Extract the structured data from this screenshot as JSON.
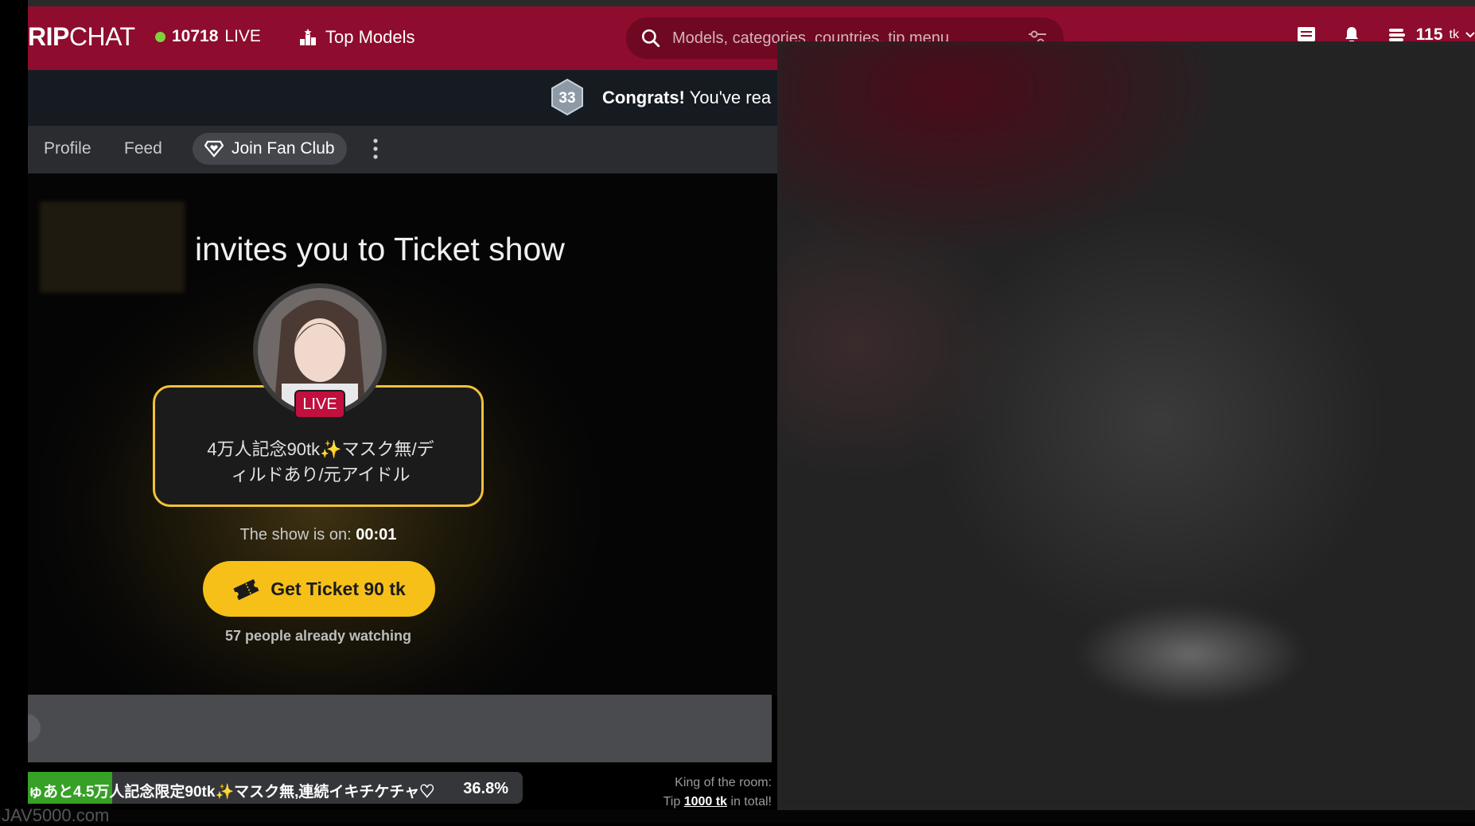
{
  "header": {
    "logo_bold": "RIP",
    "logo_light": "CHAT",
    "live_count": "10718",
    "live_label": "LIVE",
    "top_models": "Top Models",
    "search_placeholder": "Models, categories, countries, tip menu",
    "balance_value": "115",
    "balance_unit": "tk"
  },
  "congrats": {
    "level": "33",
    "title": "Congrats!",
    "message": "You've rea"
  },
  "tabs": {
    "profile": "Profile",
    "feed": "Feed",
    "join_fan_club": "Join Fan Club"
  },
  "ticket_show": {
    "invite_text": "invites you to Ticket show",
    "live_badge": "LIVE",
    "show_title_line1": "4万人記念90tk✨マスク無/デ",
    "show_title_line2": "ィルドあり/元アイドル",
    "timer_label": "The show is on:",
    "timer_value": "00:01",
    "ticket_button": "Get Ticket 90 tk",
    "watching": "57 people already watching"
  },
  "goal": {
    "text": "ゅあと4.5万人記念限定90tk✨マスク無,連続イキチケチャ♡",
    "percent_label": "36.8%",
    "progress_fraction": 0.368
  },
  "king": {
    "line1": "King of the room:",
    "tip_prefix": "Tip",
    "tip_amount": "1000 tk",
    "tip_suffix": "in total!"
  },
  "watermark": "JAV5000.com",
  "colors": {
    "header_bg": "#8e0c2d",
    "accent_yellow": "#f6c019",
    "live_red": "#c10f3e",
    "goal_green": "#37a027"
  }
}
